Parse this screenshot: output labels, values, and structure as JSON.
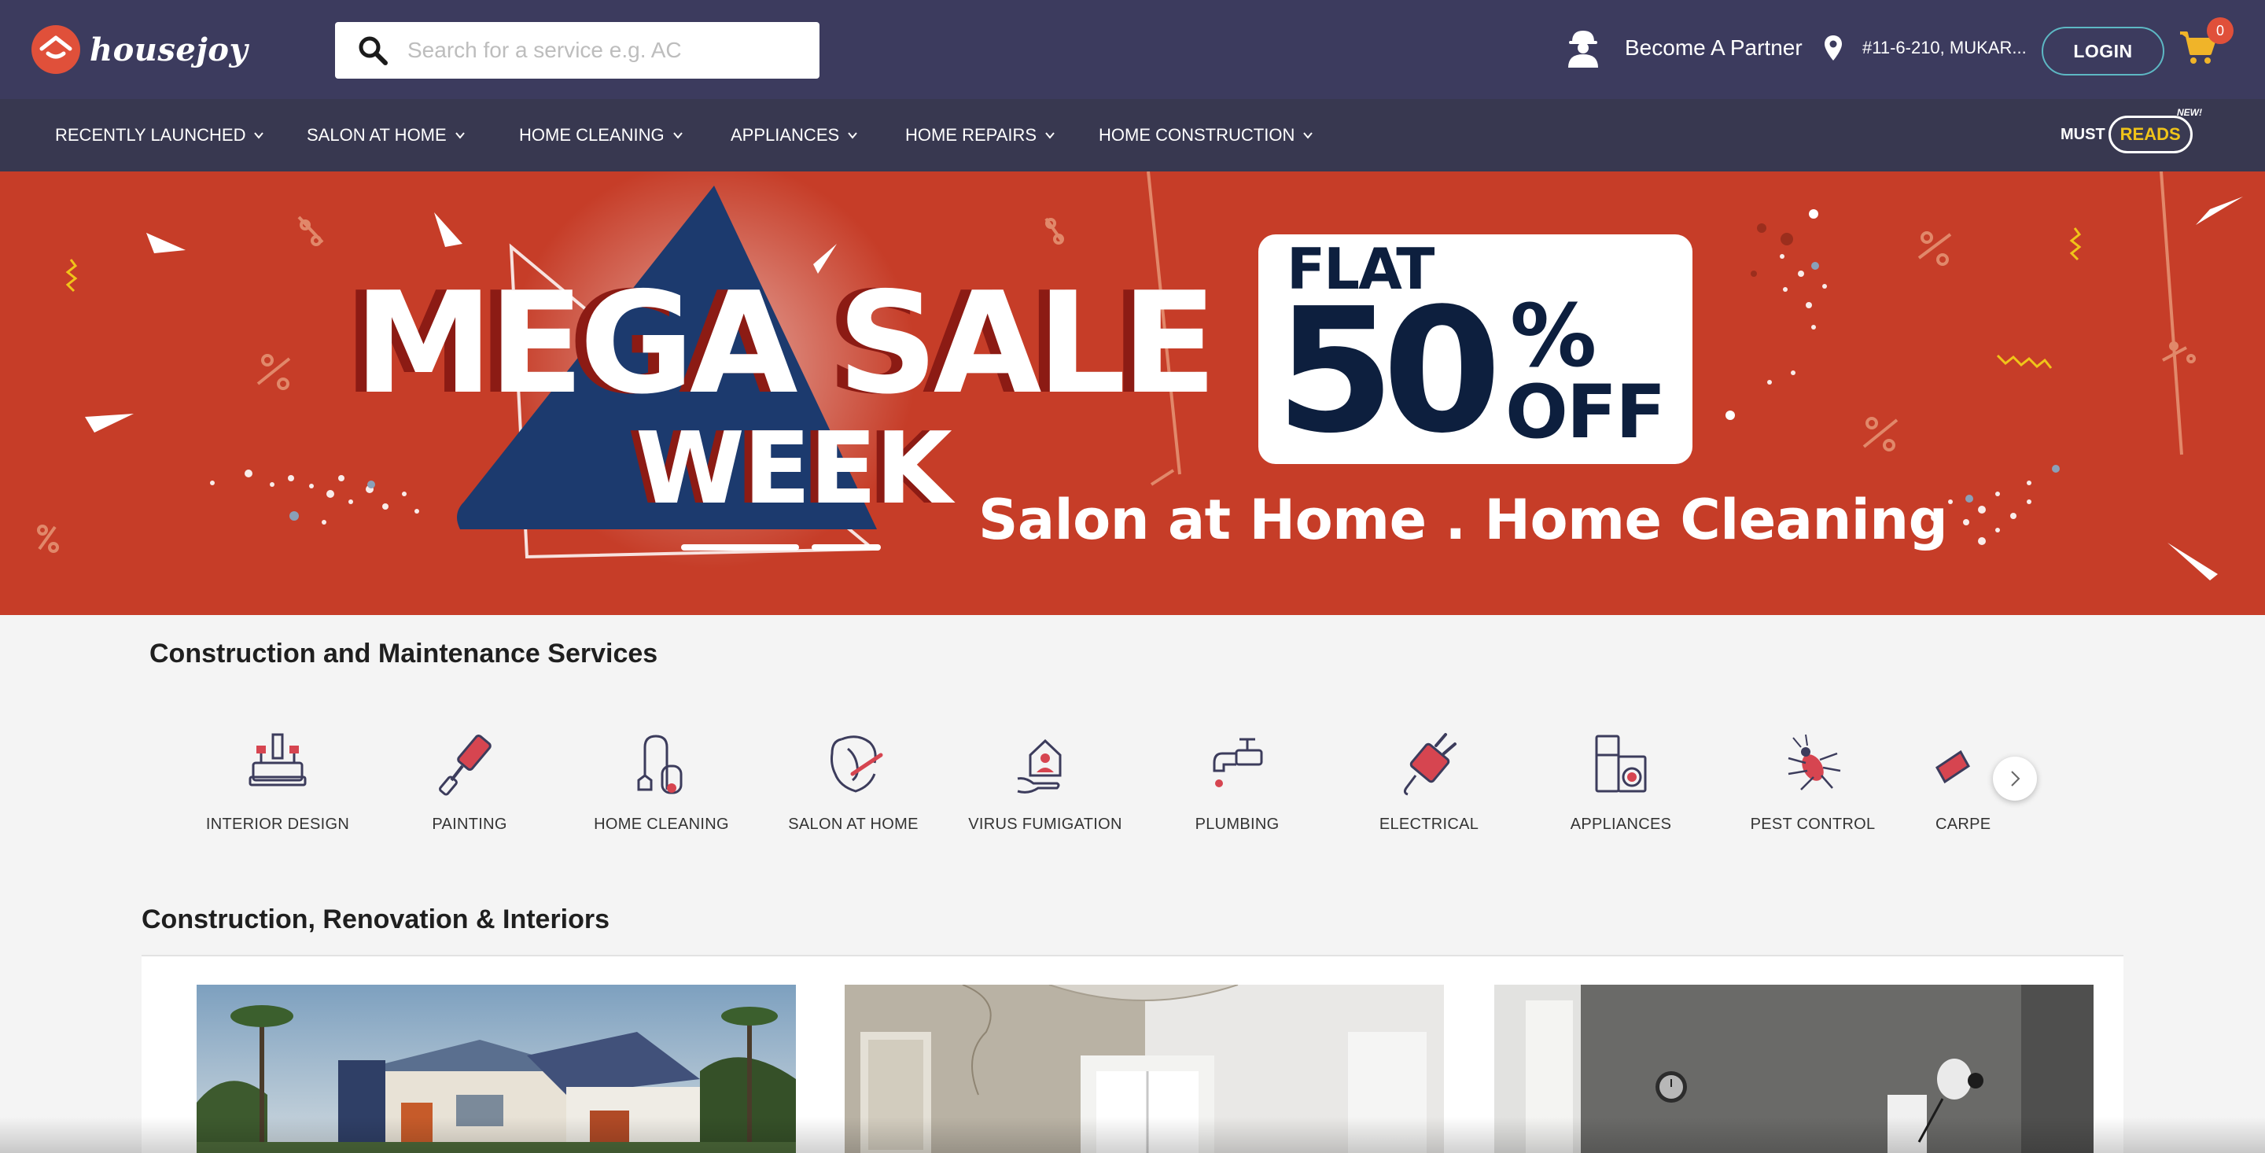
{
  "header": {
    "brand": "housejoy",
    "search_placeholder": "Search for a service e.g. AC",
    "partner_label": "Become A Partner",
    "location_label": "#11-6-210, MUKAR...",
    "login_label": "LOGIN",
    "cart_count": "0"
  },
  "nav": {
    "items": [
      {
        "label": "RECENTLY LAUNCHED"
      },
      {
        "label": "SALON AT HOME"
      },
      {
        "label": "HOME CLEANING"
      },
      {
        "label": "APPLIANCES"
      },
      {
        "label": "HOME REPAIRS"
      },
      {
        "label": "HOME CONSTRUCTION"
      }
    ],
    "must_reads": {
      "must": "MUST",
      "reads": "READS",
      "badge": "NEW!"
    }
  },
  "banner": {
    "headline": "MEGA SALE",
    "headline2": "WEEK",
    "flat": "FLAT",
    "discount": "50",
    "percent": "%",
    "off": "OFF",
    "subtitle": "Salon at Home . Home Cleaning",
    "colors": {
      "background": "#c63d28",
      "triangle": "#1c3a6e",
      "offer_text": "#0d1f3e"
    }
  },
  "services": {
    "title": "Construction and Maintenance Services",
    "items": [
      {
        "label": "INTERIOR DESIGN",
        "icon": "interior-design-icon"
      },
      {
        "label": "PAINTING",
        "icon": "paint-roller-icon"
      },
      {
        "label": "HOME CLEANING",
        "icon": "vacuum-cleaner-icon"
      },
      {
        "label": "SALON AT HOME",
        "icon": "salon-icon"
      },
      {
        "label": "VIRUS FUMIGATION",
        "icon": "virus-fumigation-icon"
      },
      {
        "label": "PLUMBING",
        "icon": "faucet-icon"
      },
      {
        "label": "ELECTRICAL",
        "icon": "electric-plug-icon"
      },
      {
        "label": "APPLIANCES",
        "icon": "appliances-icon"
      },
      {
        "label": "PEST CONTROL",
        "icon": "pest-icon"
      },
      {
        "label": "CARPE",
        "icon": "carpentry-icon"
      }
    ]
  },
  "construction": {
    "title": "Construction, Renovation & Interiors",
    "cards": [
      {
        "image": "modern-house-photo"
      },
      {
        "image": "room-renovation-photo"
      },
      {
        "image": "grey-interior-photo"
      }
    ]
  },
  "colors": {
    "header_bg": "#3c3b5e",
    "nav_bg": "#383850",
    "accent": "#e0503a",
    "login_border": "#5db8c4",
    "cart": "#f0b429"
  }
}
